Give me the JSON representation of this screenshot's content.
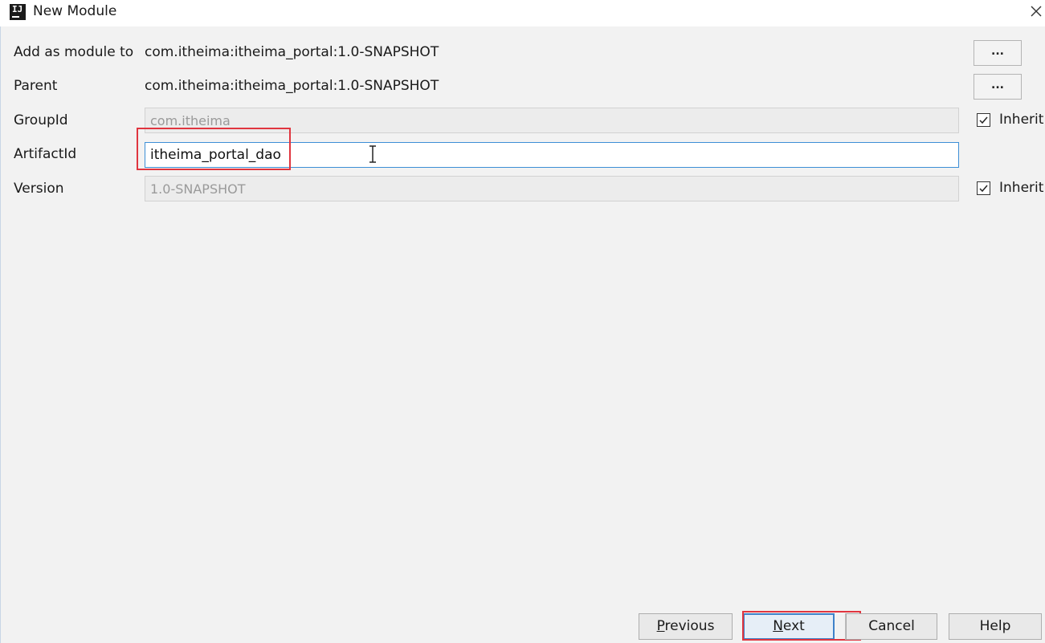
{
  "window": {
    "title": "New Module",
    "app_icon_letters": "IJ",
    "close_icon": "close-icon"
  },
  "form": {
    "add_as_module_to": {
      "label": "Add as module to",
      "value": "com.itheima:itheima_portal:1.0-SNAPSHOT",
      "button": "..."
    },
    "parent": {
      "label": "Parent",
      "value": "com.itheima:itheima_portal:1.0-SNAPSHOT",
      "button": "..."
    },
    "group_id": {
      "label": "GroupId",
      "value": "com.itheima",
      "inherit_label": "Inherit",
      "inherit_checked": true
    },
    "artifact_id": {
      "label": "ArtifactId",
      "value": "itheima_portal_dao"
    },
    "version": {
      "label": "Version",
      "value": "1.0-SNAPSHOT",
      "inherit_label": "Inherit",
      "inherit_checked": true
    }
  },
  "footer": {
    "previous": {
      "mnemonic": "P",
      "rest": "revious"
    },
    "next": {
      "mnemonic": "N",
      "rest": "ext"
    },
    "cancel": "Cancel",
    "help": "Help"
  },
  "colors": {
    "highlight": "#e0353f",
    "focus_border": "#3d8fd6",
    "dialog_bg": "#f2f2f2"
  }
}
